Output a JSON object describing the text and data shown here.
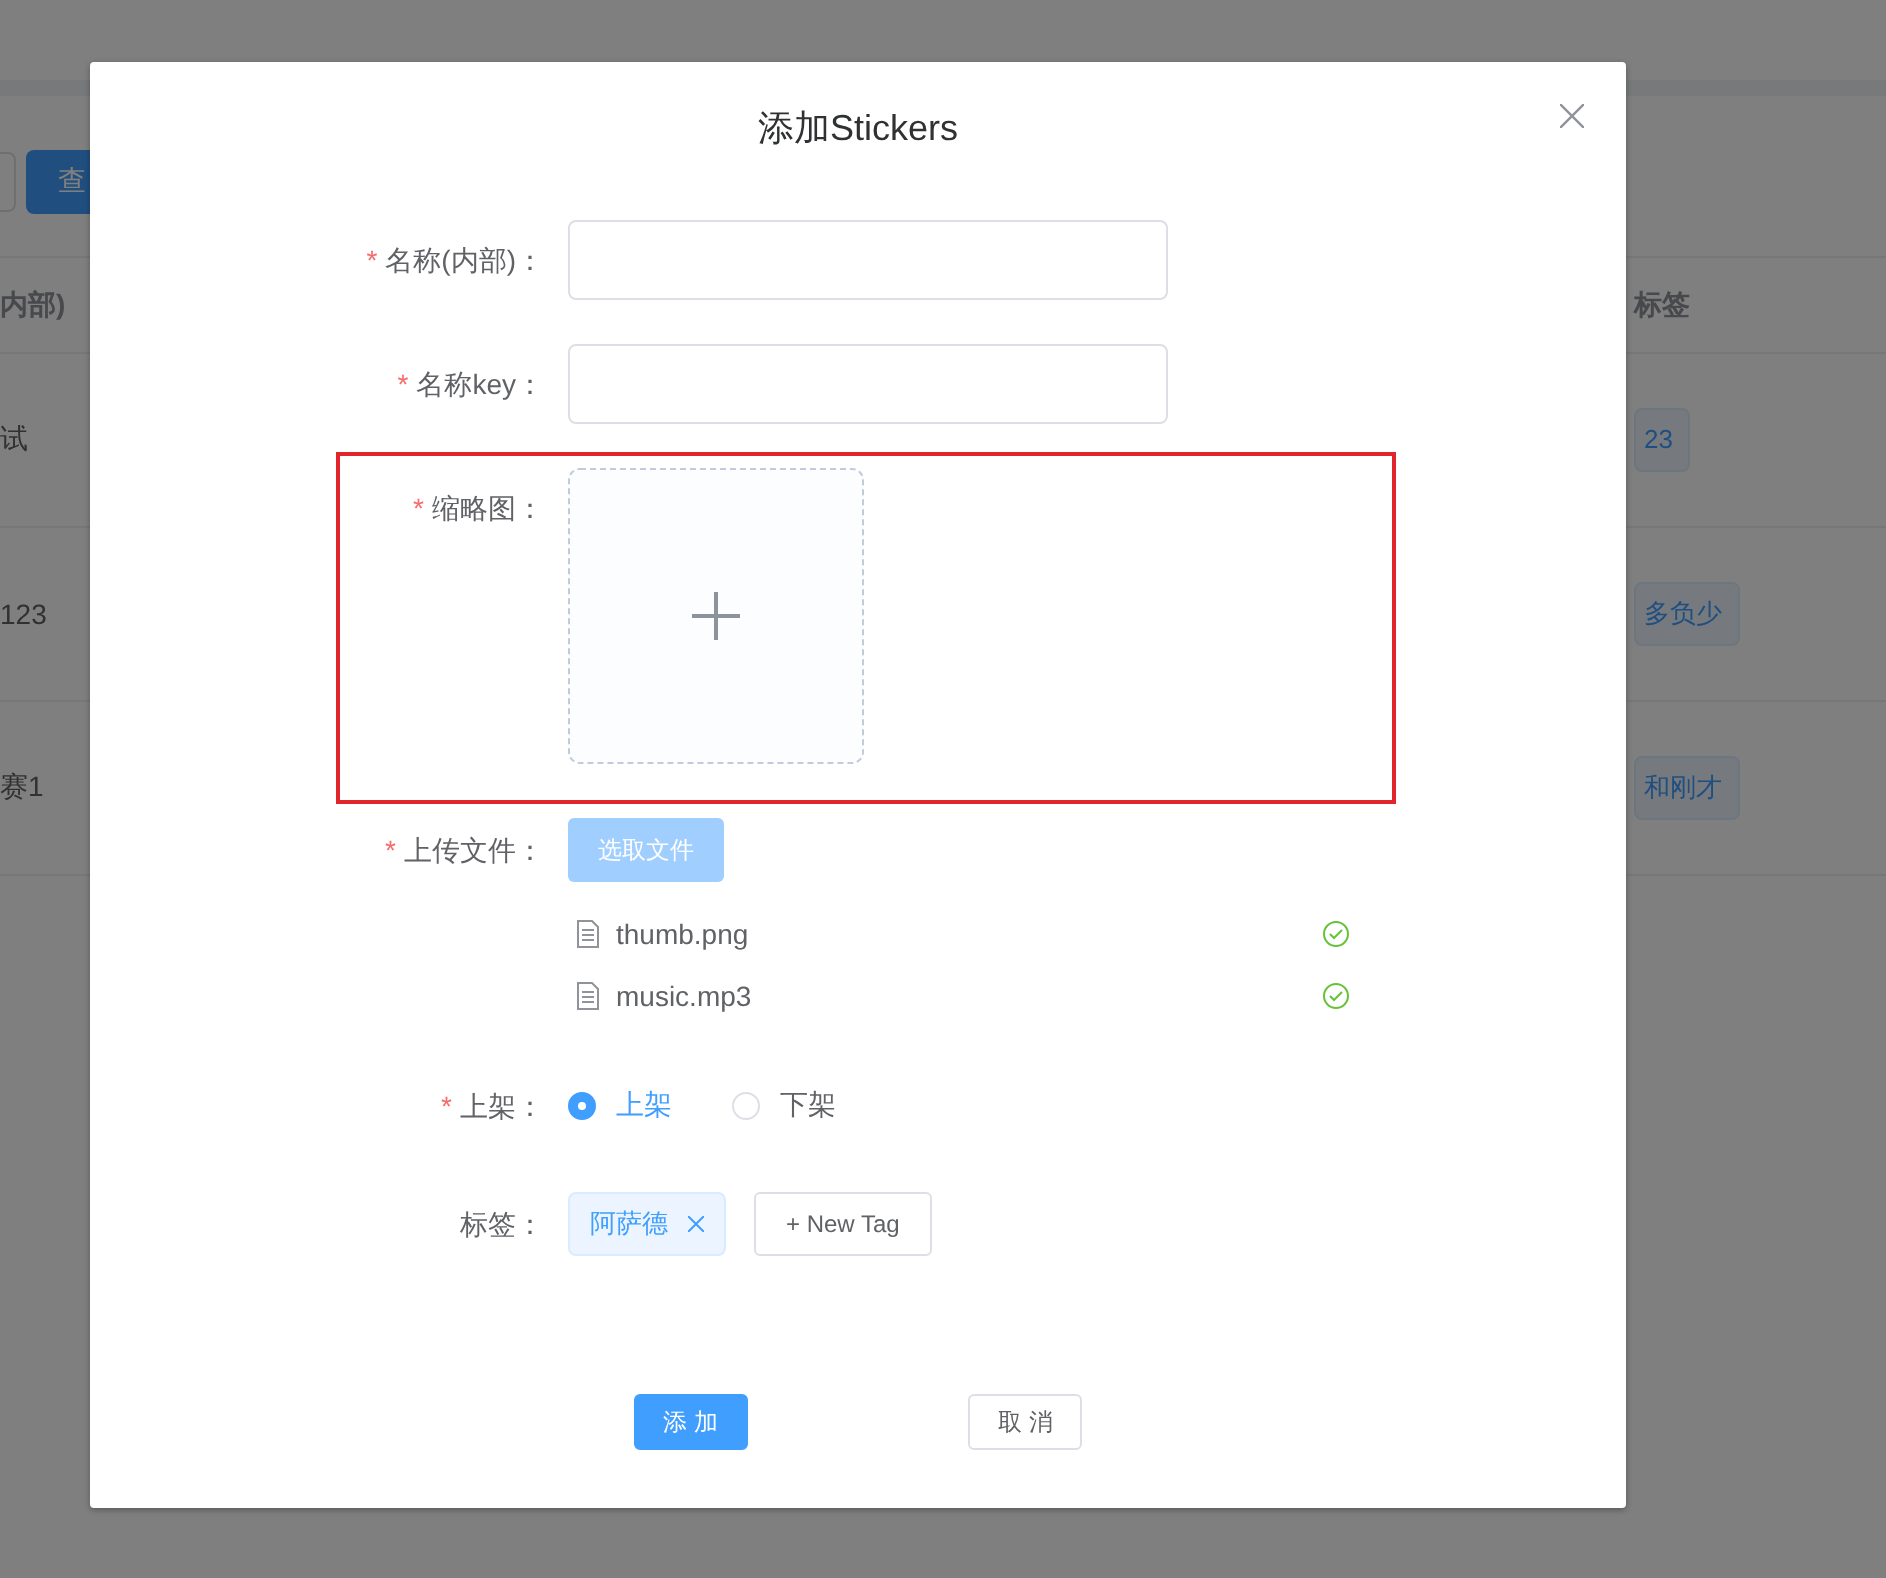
{
  "background_page": {
    "toolbar": {
      "search_button": "查"
    },
    "table": {
      "columns": [
        "内部)",
        "标签"
      ],
      "rows": [
        {
          "column_1": "试",
          "tag": "23"
        },
        {
          "column_1": "123",
          "tag": "多负少"
        },
        {
          "column_1": "赛1",
          "tag": "和刚才"
        }
      ]
    }
  },
  "dialog": {
    "title": "添加Stickers",
    "form": [
      {
        "kind": "input",
        "label": "名称(内部)：",
        "required_mark": "*"
      },
      {
        "kind": "input",
        "label": "名称key：",
        "required_mark": "*"
      },
      {
        "kind": "thumbnail",
        "label": "缩略图：",
        "required_mark": "*",
        "highlighted": true
      },
      {
        "kind": "upload",
        "label": "上传文件：",
        "required_mark": "*",
        "button": "选取文件",
        "disabled": true,
        "files": [
          {
            "name": "thumb.png",
            "uploaded": true
          },
          {
            "name": "music.mp3",
            "uploaded": true
          }
        ]
      },
      {
        "kind": "radio",
        "label": "上架：",
        "required_mark": "*",
        "options": [
          {
            "label": "上架",
            "selected": true
          },
          {
            "label": "下架",
            "selected": false
          }
        ]
      },
      {
        "kind": "tags",
        "label": "标签：",
        "tags": [
          "阿萨德"
        ],
        "new_tag_button": "+ New Tag"
      }
    ],
    "buttons": [
      {
        "label": "添 加",
        "kind": "primary"
      },
      {
        "label": "取 消",
        "kind": "default"
      }
    ]
  }
}
